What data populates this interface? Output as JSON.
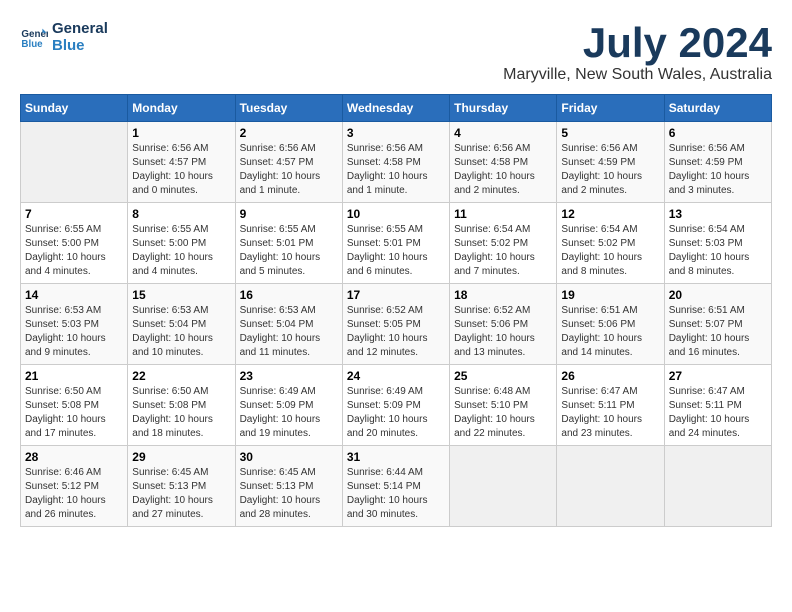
{
  "logo": {
    "line1": "General",
    "line2": "Blue"
  },
  "title": "July 2024",
  "subtitle": "Maryville, New South Wales, Australia",
  "days_header": [
    "Sunday",
    "Monday",
    "Tuesday",
    "Wednesday",
    "Thursday",
    "Friday",
    "Saturday"
  ],
  "weeks": [
    [
      {
        "day": "",
        "info": ""
      },
      {
        "day": "1",
        "info": "Sunrise: 6:56 AM\nSunset: 4:57 PM\nDaylight: 10 hours\nand 0 minutes."
      },
      {
        "day": "2",
        "info": "Sunrise: 6:56 AM\nSunset: 4:57 PM\nDaylight: 10 hours\nand 1 minute."
      },
      {
        "day": "3",
        "info": "Sunrise: 6:56 AM\nSunset: 4:58 PM\nDaylight: 10 hours\nand 1 minute."
      },
      {
        "day": "4",
        "info": "Sunrise: 6:56 AM\nSunset: 4:58 PM\nDaylight: 10 hours\nand 2 minutes."
      },
      {
        "day": "5",
        "info": "Sunrise: 6:56 AM\nSunset: 4:59 PM\nDaylight: 10 hours\nand 2 minutes."
      },
      {
        "day": "6",
        "info": "Sunrise: 6:56 AM\nSunset: 4:59 PM\nDaylight: 10 hours\nand 3 minutes."
      }
    ],
    [
      {
        "day": "7",
        "info": "Sunrise: 6:55 AM\nSunset: 5:00 PM\nDaylight: 10 hours\nand 4 minutes."
      },
      {
        "day": "8",
        "info": "Sunrise: 6:55 AM\nSunset: 5:00 PM\nDaylight: 10 hours\nand 4 minutes."
      },
      {
        "day": "9",
        "info": "Sunrise: 6:55 AM\nSunset: 5:01 PM\nDaylight: 10 hours\nand 5 minutes."
      },
      {
        "day": "10",
        "info": "Sunrise: 6:55 AM\nSunset: 5:01 PM\nDaylight: 10 hours\nand 6 minutes."
      },
      {
        "day": "11",
        "info": "Sunrise: 6:54 AM\nSunset: 5:02 PM\nDaylight: 10 hours\nand 7 minutes."
      },
      {
        "day": "12",
        "info": "Sunrise: 6:54 AM\nSunset: 5:02 PM\nDaylight: 10 hours\nand 8 minutes."
      },
      {
        "day": "13",
        "info": "Sunrise: 6:54 AM\nSunset: 5:03 PM\nDaylight: 10 hours\nand 8 minutes."
      }
    ],
    [
      {
        "day": "14",
        "info": "Sunrise: 6:53 AM\nSunset: 5:03 PM\nDaylight: 10 hours\nand 9 minutes."
      },
      {
        "day": "15",
        "info": "Sunrise: 6:53 AM\nSunset: 5:04 PM\nDaylight: 10 hours\nand 10 minutes."
      },
      {
        "day": "16",
        "info": "Sunrise: 6:53 AM\nSunset: 5:04 PM\nDaylight: 10 hours\nand 11 minutes."
      },
      {
        "day": "17",
        "info": "Sunrise: 6:52 AM\nSunset: 5:05 PM\nDaylight: 10 hours\nand 12 minutes."
      },
      {
        "day": "18",
        "info": "Sunrise: 6:52 AM\nSunset: 5:06 PM\nDaylight: 10 hours\nand 13 minutes."
      },
      {
        "day": "19",
        "info": "Sunrise: 6:51 AM\nSunset: 5:06 PM\nDaylight: 10 hours\nand 14 minutes."
      },
      {
        "day": "20",
        "info": "Sunrise: 6:51 AM\nSunset: 5:07 PM\nDaylight: 10 hours\nand 16 minutes."
      }
    ],
    [
      {
        "day": "21",
        "info": "Sunrise: 6:50 AM\nSunset: 5:08 PM\nDaylight: 10 hours\nand 17 minutes."
      },
      {
        "day": "22",
        "info": "Sunrise: 6:50 AM\nSunset: 5:08 PM\nDaylight: 10 hours\nand 18 minutes."
      },
      {
        "day": "23",
        "info": "Sunrise: 6:49 AM\nSunset: 5:09 PM\nDaylight: 10 hours\nand 19 minutes."
      },
      {
        "day": "24",
        "info": "Sunrise: 6:49 AM\nSunset: 5:09 PM\nDaylight: 10 hours\nand 20 minutes."
      },
      {
        "day": "25",
        "info": "Sunrise: 6:48 AM\nSunset: 5:10 PM\nDaylight: 10 hours\nand 22 minutes."
      },
      {
        "day": "26",
        "info": "Sunrise: 6:47 AM\nSunset: 5:11 PM\nDaylight: 10 hours\nand 23 minutes."
      },
      {
        "day": "27",
        "info": "Sunrise: 6:47 AM\nSunset: 5:11 PM\nDaylight: 10 hours\nand 24 minutes."
      }
    ],
    [
      {
        "day": "28",
        "info": "Sunrise: 6:46 AM\nSunset: 5:12 PM\nDaylight: 10 hours\nand 26 minutes."
      },
      {
        "day": "29",
        "info": "Sunrise: 6:45 AM\nSunset: 5:13 PM\nDaylight: 10 hours\nand 27 minutes."
      },
      {
        "day": "30",
        "info": "Sunrise: 6:45 AM\nSunset: 5:13 PM\nDaylight: 10 hours\nand 28 minutes."
      },
      {
        "day": "31",
        "info": "Sunrise: 6:44 AM\nSunset: 5:14 PM\nDaylight: 10 hours\nand 30 minutes."
      },
      {
        "day": "",
        "info": ""
      },
      {
        "day": "",
        "info": ""
      },
      {
        "day": "",
        "info": ""
      }
    ]
  ]
}
